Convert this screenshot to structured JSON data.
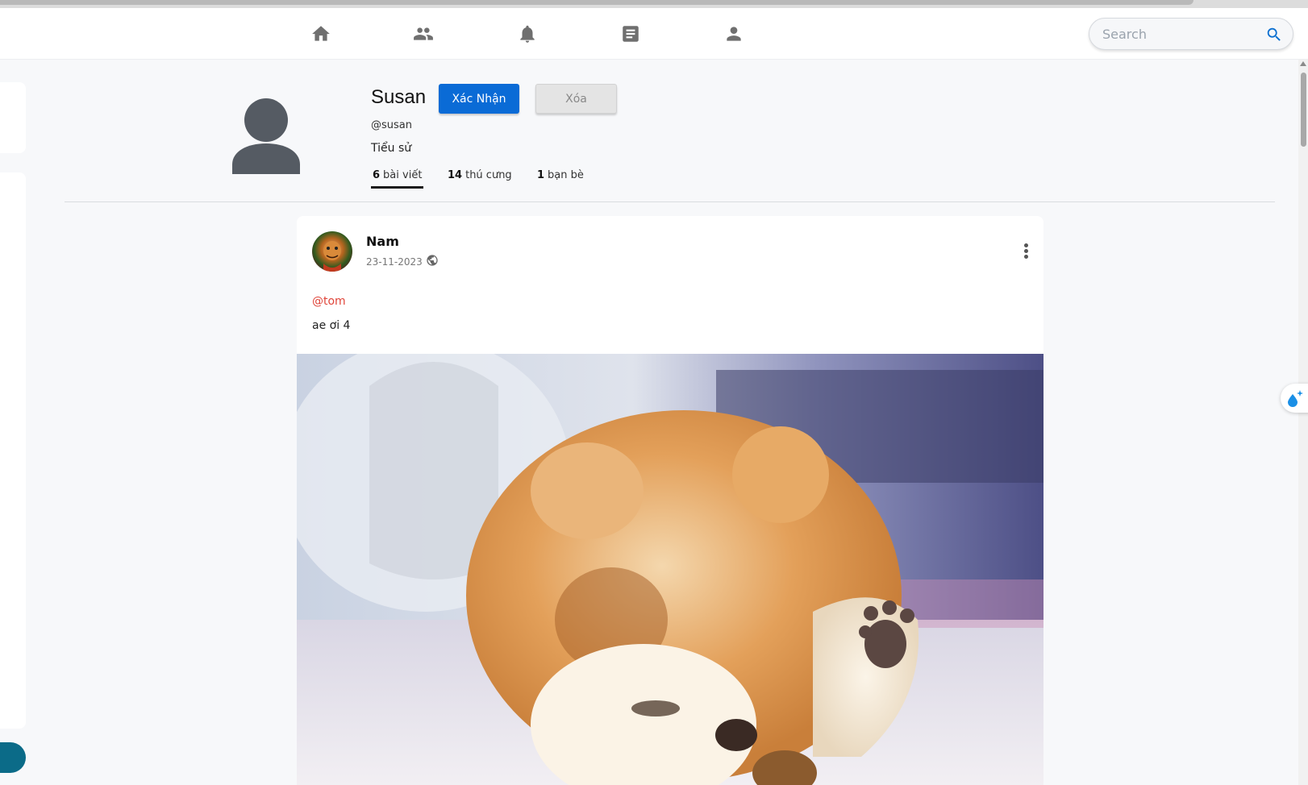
{
  "search": {
    "placeholder": "Search"
  },
  "nav": {
    "items": [
      {
        "icon": "home-icon"
      },
      {
        "icon": "friends-icon"
      },
      {
        "icon": "bell-icon"
      },
      {
        "icon": "posts-icon"
      },
      {
        "icon": "profile-icon"
      }
    ]
  },
  "profile": {
    "name": "Susan",
    "handle": "@susan",
    "bio": "Tiểu sử",
    "confirm_label": "Xác Nhận",
    "delete_label": "Xóa",
    "stats": {
      "posts_count": "6",
      "posts_label": "bài viết",
      "pets_count": "14",
      "pets_label": "thú cưng",
      "friends_count": "1",
      "friends_label": "bạn bè"
    }
  },
  "post": {
    "author": "Nam",
    "date": "23-11-2023",
    "visibility_icon": "globe-icon",
    "mention": "@tom",
    "text": "ae ơi 4"
  },
  "colors": {
    "accent": "#0a6bd6",
    "mention": "#e0453a",
    "background": "#f7f8fa"
  }
}
